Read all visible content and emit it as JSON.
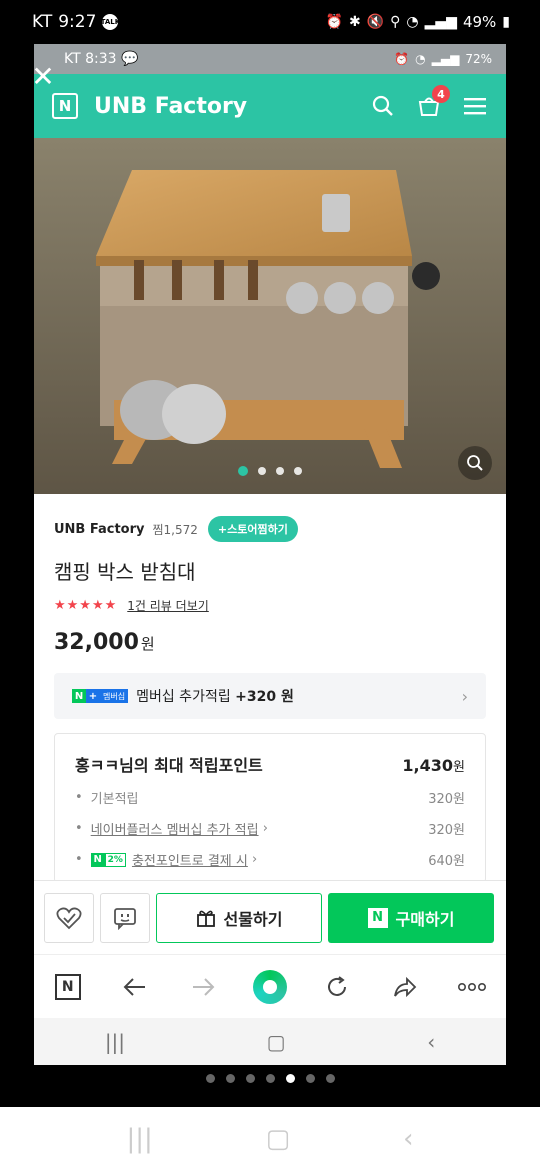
{
  "outer_status": {
    "carrier": "KT",
    "time": "9:27",
    "talk": "TALK",
    "battery": "49%"
  },
  "inner_status": {
    "carrier": "KT",
    "time": "8:33",
    "battery": "72%"
  },
  "header": {
    "logo": "N",
    "brand": "UNB Factory",
    "cart_count": "4"
  },
  "hero": {
    "slide_count": 4,
    "active_slide": 0
  },
  "store": {
    "name": "UNB Factory",
    "favorites": "찜1,572",
    "store_fav_button": "+스토어찜하기"
  },
  "product": {
    "title": "캠핑 박스 받침대",
    "stars": "★★★★★",
    "review_link": "1건 리뷰 더보기",
    "price": "32,000",
    "price_unit": "원"
  },
  "membership": {
    "badge_n": "N",
    "badge_plus": "+",
    "badge_label": "멤버십",
    "text_prefix": "멤버십 추가적립 ",
    "text_amount": "+320 원"
  },
  "points": {
    "title": "홍ㅋㅋ님의 최대 적립포인트",
    "total": "1,430",
    "total_unit": "원",
    "rows": [
      {
        "label": "기본적립",
        "value": "320원"
      },
      {
        "label": "네이버플러스 멤버십 추가 적립",
        "value": "320원"
      },
      {
        "label": "충전포인트로 결제 시",
        "value": "640원",
        "badge": "2%"
      }
    ]
  },
  "actions": {
    "gift": "선물하기",
    "buy": "구매하기",
    "buy_n": "N"
  },
  "browser": {
    "home_n": "N"
  },
  "page_dots": {
    "count": 7,
    "active": 4
  },
  "colors": {
    "brand_teal": "#2cc4a4",
    "naver_green": "#03c75a",
    "star_red": "#f2444c"
  }
}
